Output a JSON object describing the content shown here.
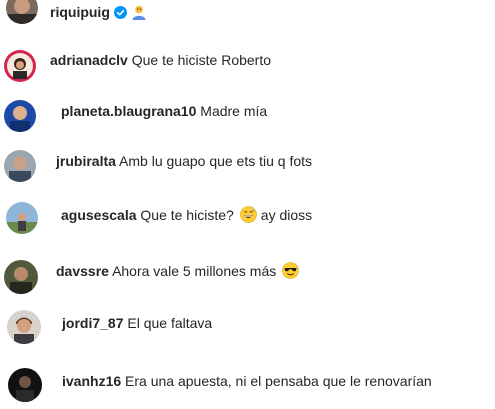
{
  "header": {
    "username": "riquipuig",
    "verified_icon": "verified-badge-icon",
    "emoji_icon": "person-emoji"
  },
  "comments": [
    {
      "username": "adrianadclv",
      "text": "Que te hiciste Roberto"
    },
    {
      "username": "planeta.blaugrana10",
      "text": "Madre mía"
    },
    {
      "username": "jrubiralta",
      "text": "Amb lu guapo que ets tiu q fots"
    },
    {
      "username": "agusescala",
      "text": "Que te hiciste?",
      "emoji_after": "grinning-sweat-face",
      "text_after": "ay dioss"
    },
    {
      "username": "davssre",
      "text": "Ahora vale 5 millones más",
      "emoji_after": "sunglasses-face"
    },
    {
      "username": "jordi7_87",
      "text": "El que faltava"
    },
    {
      "username": "ivanhz16",
      "text": "Era una apuesta, ni el pensaba que le renovarían"
    }
  ],
  "colors": {
    "text": "#262626",
    "verified": "#0095f6",
    "background": "#ffffff"
  }
}
